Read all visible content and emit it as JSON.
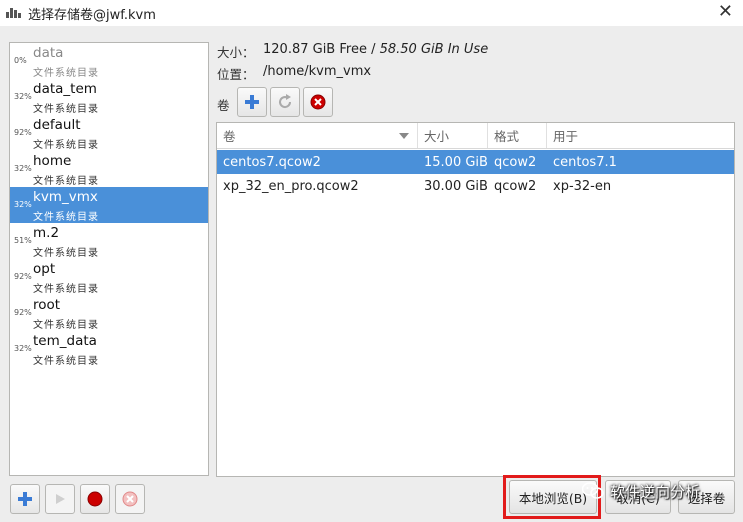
{
  "window": {
    "title": "选择存储卷@jwf.kvm"
  },
  "pools": [
    {
      "usage": "0%",
      "name": "data",
      "type": "文件系统目录",
      "inactive": true
    },
    {
      "usage": "32%",
      "name": "data_tem",
      "type": "文件系统目录"
    },
    {
      "usage": "92%",
      "name": "default",
      "type": "文件系统目录"
    },
    {
      "usage": "32%",
      "name": "home",
      "type": "文件系统目录"
    },
    {
      "usage": "32%",
      "name": "kvm_vmx",
      "type": "文件系统目录",
      "selected": true
    },
    {
      "usage": "51%",
      "name": "m.2",
      "type": "文件系统目录"
    },
    {
      "usage": "92%",
      "name": "opt",
      "type": "文件系统目录"
    },
    {
      "usage": "92%",
      "name": "root",
      "type": "文件系统目录"
    },
    {
      "usage": "32%",
      "name": "tem_data",
      "type": "文件系统目录"
    }
  ],
  "info": {
    "size_label": "大小：",
    "size_free": "120.87 GiB Free",
    "size_sep": " / ",
    "size_inuse": "58.50 GiB In Use",
    "location_label": "位置：",
    "location_value": "/home/kvm_vmx"
  },
  "volumes_toolbar": {
    "label": "卷"
  },
  "volume_table": {
    "headers": [
      "卷",
      "大小",
      "格式",
      "用于"
    ],
    "rows": [
      {
        "name": "centos7.qcow2",
        "size": "15.00 GiB",
        "format": "qcow2",
        "used_by": "centos7.1",
        "selected": true
      },
      {
        "name": "xp_32_en_pro.qcow2",
        "size": "30.00 GiB",
        "format": "qcow2",
        "used_by": "xp-32-en"
      }
    ]
  },
  "actions": {
    "browse_local": "本地浏览(B)",
    "cancel": "取消(C)",
    "choose_volume": "选择卷"
  },
  "watermark": {
    "text": "软件逆向分析"
  },
  "colors": {
    "selection": "#4a90d9",
    "highlight_border": "#e21b1b",
    "add_icon": "#3a7bd5",
    "stop_icon": "#cc0000"
  }
}
